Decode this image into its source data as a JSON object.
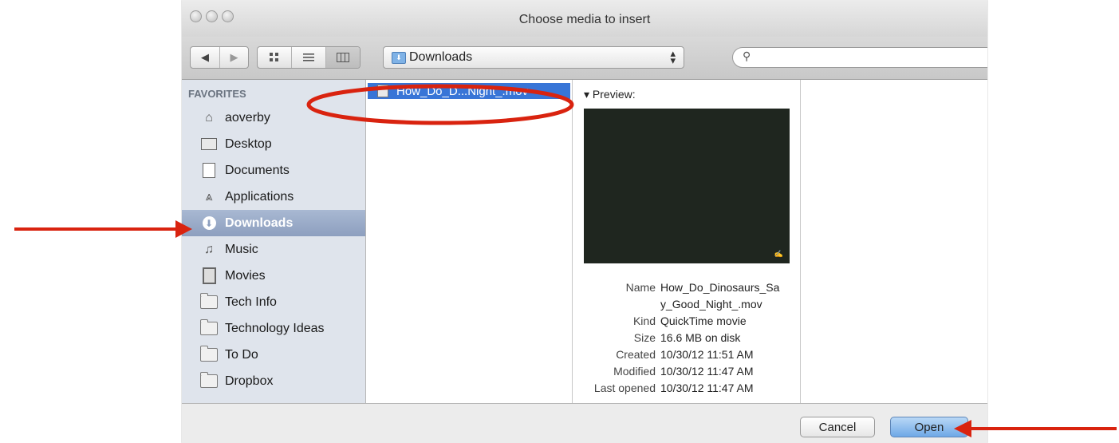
{
  "window": {
    "title": "Choose media to insert"
  },
  "toolbar": {
    "back_icon": "◀",
    "forward_icon": "▶",
    "view_icons": [
      "icon-view",
      "list-view",
      "column-view"
    ],
    "location": "Downloads",
    "search_placeholder": ""
  },
  "sidebar": {
    "header": "FAVORITES",
    "items": [
      {
        "label": "aoverby",
        "icon": "home-icon"
      },
      {
        "label": "Desktop",
        "icon": "desktop-icon"
      },
      {
        "label": "Documents",
        "icon": "documents-icon"
      },
      {
        "label": "Applications",
        "icon": "applications-icon"
      },
      {
        "label": "Downloads",
        "icon": "downloads-icon",
        "selected": true
      },
      {
        "label": "Music",
        "icon": "music-icon"
      },
      {
        "label": "Movies",
        "icon": "movies-icon"
      },
      {
        "label": "Tech Info",
        "icon": "folder-icon"
      },
      {
        "label": "Technology Ideas",
        "icon": "folder-icon"
      },
      {
        "label": "To Do",
        "icon": "folder-icon"
      },
      {
        "label": "Dropbox",
        "icon": "folder-icon"
      }
    ]
  },
  "files": [
    {
      "name": "How_Do_D...Night_.mov",
      "selected": true
    }
  ],
  "preview": {
    "label": "Preview:",
    "info": [
      {
        "key": "Name",
        "value": "How_Do_Dinosaurs_Sa y_Good_Night_.mov"
      },
      {
        "key": "Kind",
        "value": "QuickTime movie"
      },
      {
        "key": "Size",
        "value": "16.6 MB on disk"
      },
      {
        "key": "Created",
        "value": "10/30/12 11:51 AM"
      },
      {
        "key": "Modified",
        "value": "10/30/12 11:47 AM"
      },
      {
        "key": "Last opened",
        "value": "10/30/12 11:47 AM"
      }
    ]
  },
  "buttons": {
    "cancel": "Cancel",
    "open": "Open"
  },
  "colors": {
    "selection": "#3875d7",
    "annotation": "#d9230f",
    "sidebar_bg": "#dfe4ec"
  }
}
